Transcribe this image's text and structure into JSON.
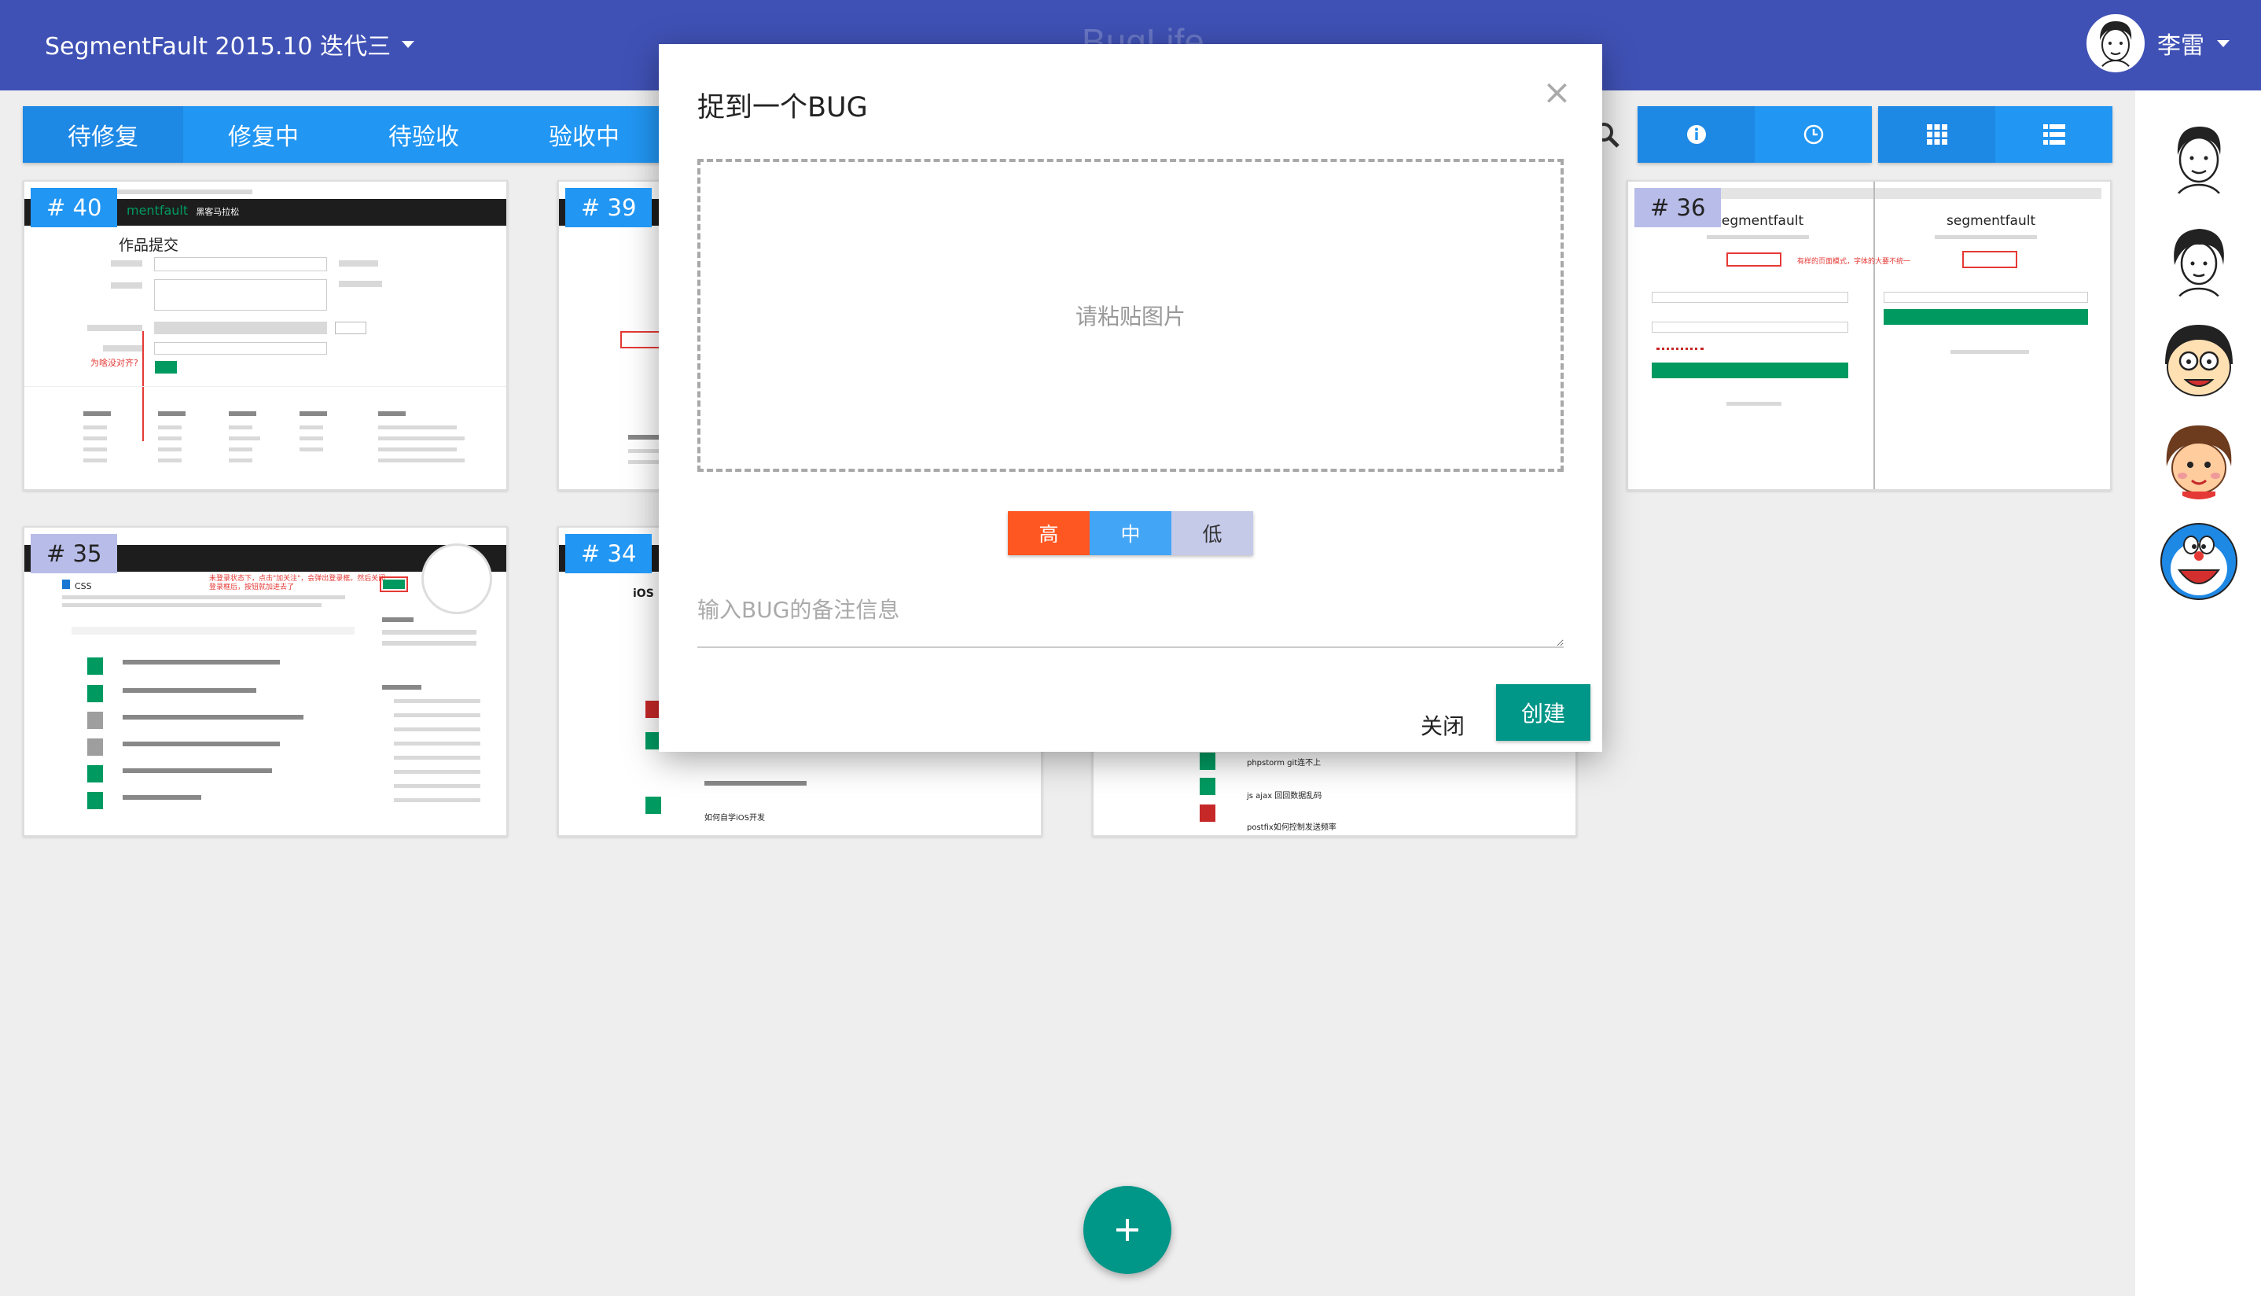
{
  "app": {
    "project_name": "SegmentFault 2015.10 迭代三",
    "brand": "BugLife",
    "user_name": "李雷"
  },
  "status_tabs": [
    {
      "label": "待修复"
    },
    {
      "label": "修复中"
    },
    {
      "label": "待验收"
    },
    {
      "label": "验收中"
    }
  ],
  "toolbar": {
    "icons": [
      "info-icon",
      "clock-icon",
      "grid-view-icon",
      "list-view-icon",
      "search-icon"
    ]
  },
  "cards": [
    {
      "id": "# 40",
      "shot_title": "作品提交",
      "shot_brand": "mentfault",
      "shot_brand2": "黑客马拉松",
      "annotation": "为啥没对齐?"
    },
    {
      "id": "# 39"
    },
    {
      "id": "# 36",
      "shot_brand": "segmentfault",
      "annotation": "有样的页面模式，字体的大要不统一"
    },
    {
      "id": "# 35",
      "shot_tag": "CSS",
      "annotation": "未登录状态下，点击\"加关注\"，会弹出登录框。然后关闭登录框后，按钮就加进去了"
    },
    {
      "id": "# 34",
      "shot_tag": "iOS",
      "row_title": "如何自学iOS开发"
    },
    {
      "id": "",
      "row_title_1": "phpstorm git连不上",
      "row_title_2": "js ajax 回回数据乱码",
      "row_title_3": "postfix如何控制发送频率"
    }
  ],
  "modal": {
    "title": "捉到一个BUG",
    "close_symbol": "×",
    "paste_hint": "请粘贴图片",
    "priorities": [
      "高",
      "中",
      "低"
    ],
    "note_placeholder": "输入BUG的备注信息",
    "close_label": "关闭",
    "create_label": "创建"
  },
  "fab": {
    "label": "+"
  },
  "colors": {
    "appbar": "#3f51b5",
    "tab": "#2196f3",
    "primary_action": "#009688",
    "priority_high": "#ff5722",
    "priority_mid": "#42a5f5",
    "priority_low": "#c5cae9"
  }
}
